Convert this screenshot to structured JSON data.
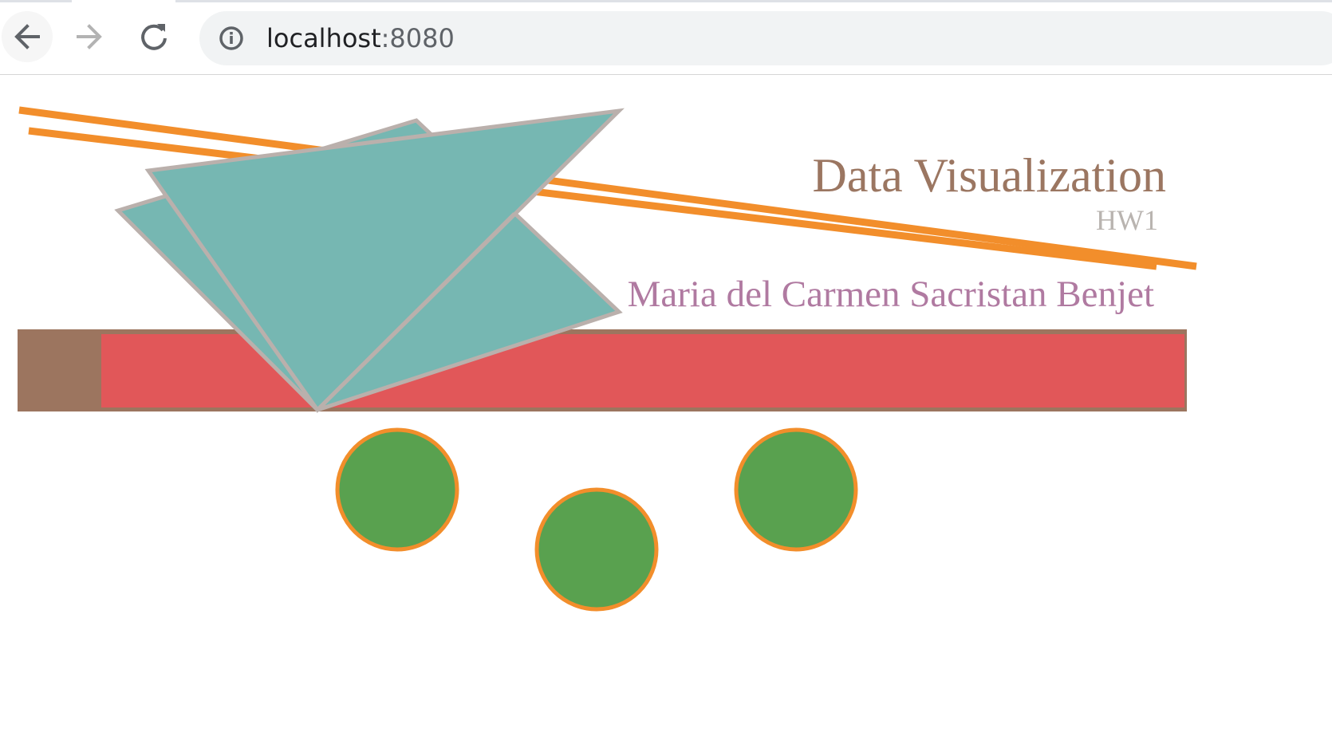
{
  "browser": {
    "url_host": "localhost",
    "url_port": ":8080",
    "icons": {
      "back": "arrow-left-icon",
      "forward": "arrow-right-icon",
      "reload": "reload-icon",
      "info": "info-circle-icon"
    }
  },
  "page": {
    "title": "Data Visualization",
    "subtitle": "HW1",
    "author": "Maria del Carmen Sacristan Benjet"
  },
  "colors": {
    "title": "#9b7661",
    "subtitle": "#b9b4b0",
    "author": "#b07aa1",
    "line": "#f28e2b",
    "bar_fill": "#e15759",
    "bar_border": "#9c755f",
    "triangle_fill": "#76b7b2",
    "triangle_stroke": "#bab0ac",
    "circle_fill": "#59a14f",
    "circle_stroke": "#f28e2b"
  }
}
